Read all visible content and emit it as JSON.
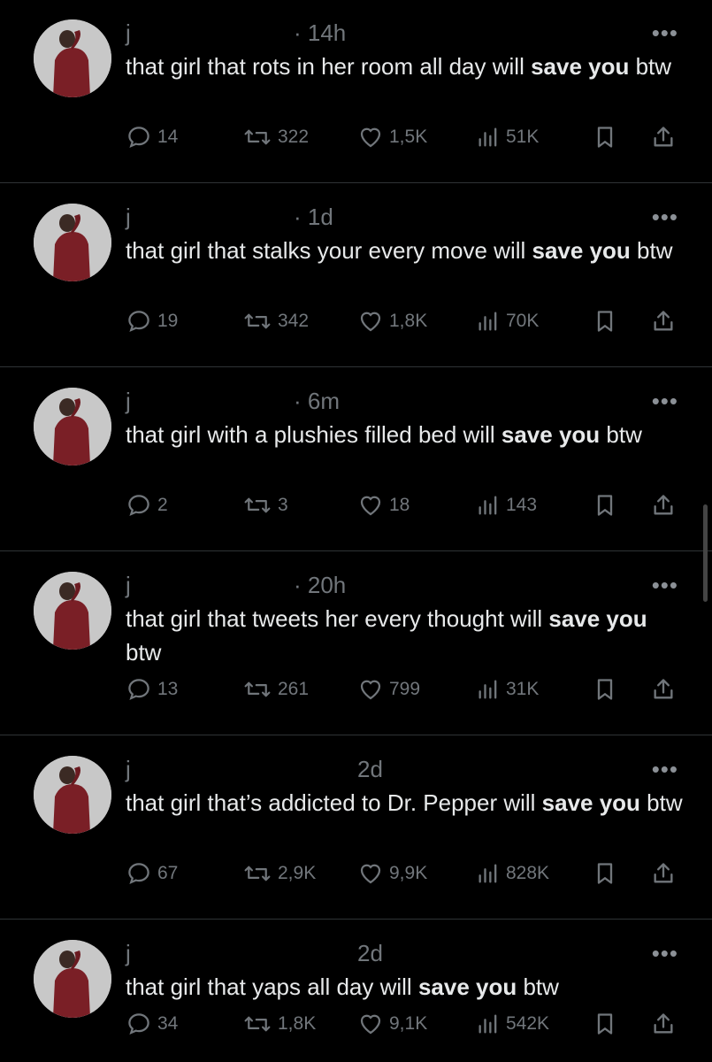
{
  "tweets": [
    {
      "handle": "j",
      "time": "· 14h",
      "text_before": "that girl that rots in her room all day will ",
      "bold": "save you",
      "text_after": " btw",
      "replies": "14",
      "retweets": "322",
      "likes": "1,5K",
      "views": "51K"
    },
    {
      "handle": "j",
      "time": "· 1d",
      "text_before": "that girl that stalks your every move will ",
      "bold": "save you",
      "text_after": " btw",
      "replies": "19",
      "retweets": "342",
      "likes": "1,8K",
      "views": "70K"
    },
    {
      "handle": "j",
      "time": "· 6m",
      "text_before": "that girl with a plushies filled bed will ",
      "bold": "save you",
      "text_after": " btw",
      "replies": "2",
      "retweets": "3",
      "likes": "18",
      "views": "143"
    },
    {
      "handle": "j",
      "time": "· 20h",
      "text_before": "that girl that tweets her every thought will ",
      "bold": "save you",
      "text_after": " btw",
      "replies": "13",
      "retweets": "261",
      "likes": "799",
      "views": "31K"
    },
    {
      "handle": "j",
      "time": "2d",
      "text_before": "that girl that’s addicted to Dr. Pepper will ",
      "bold": "save you",
      "text_after": " btw",
      "replies": "67",
      "retweets": "2,9K",
      "likes": "9,9K",
      "views": "828K"
    },
    {
      "handle": "j",
      "time": "2d",
      "text_before": "that girl that yaps all day will ",
      "bold": "save you",
      "text_after": " btw",
      "replies": "34",
      "retweets": "1,8K",
      "likes": "9,1K",
      "views": "542K"
    }
  ],
  "icons": {
    "more": "more-options-icon",
    "reply": "reply-icon",
    "retweet": "retweet-icon",
    "like": "heart-icon",
    "views": "views-icon",
    "bookmark": "bookmark-icon",
    "share": "share-icon"
  },
  "colors": {
    "background": "#000000",
    "text": "#e7e9ea",
    "muted": "#71767b",
    "divider": "#2f3336"
  },
  "more_glyph": "•••"
}
